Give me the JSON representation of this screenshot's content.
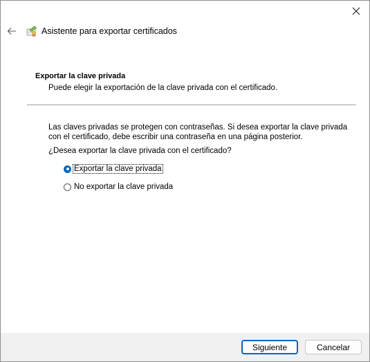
{
  "window": {
    "title": "Asistente para exportar certificados",
    "close_icon": "close-icon",
    "back_icon": "back-arrow-icon",
    "wizard_icon": "certificate-wizard-icon"
  },
  "section": {
    "title": "Exportar la clave privada",
    "subtitle": "Puede elegir la exportación de la clave privada con el certificado."
  },
  "body": {
    "description": "Las claves privadas se protegen con contraseñas. Si desea exportar la clave privada con el certificado, debe escribir una contraseña en una página posterior.",
    "question": "¿Desea exportar la clave privada con el certificado?"
  },
  "options": [
    {
      "label": "Exportar la clave privada",
      "selected": true
    },
    {
      "label": "No exportar la clave privada",
      "selected": false
    }
  ],
  "buttons": {
    "next": "Siguiente",
    "cancel": "Cancelar"
  },
  "colors": {
    "accent": "#0067c0",
    "footer_bg": "#f0f0f0"
  }
}
